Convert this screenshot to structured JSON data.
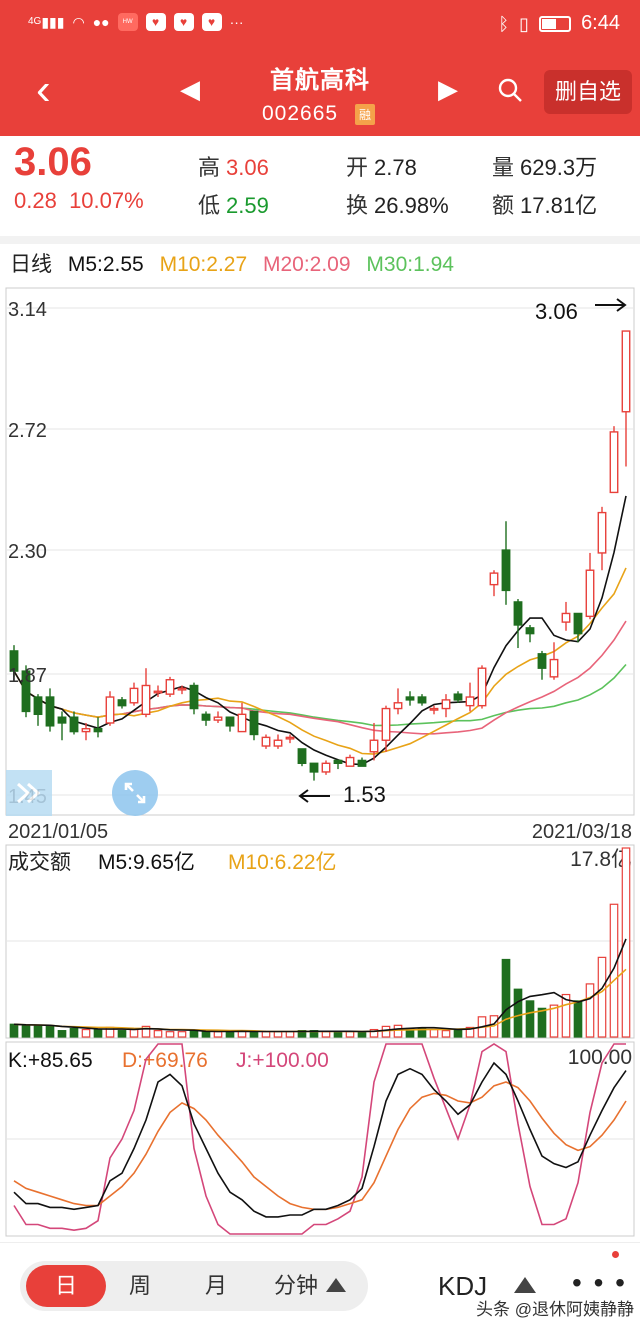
{
  "status_bar": {
    "network": "4G",
    "time": "6:44",
    "icons": [
      "signal-icon",
      "wifi-icon",
      "wechat-icon",
      "huawei-icon",
      "heart-icon",
      "heart-icon",
      "heart-icon",
      "more-dots-icon",
      "bluetooth-icon",
      "vibrate-icon",
      "battery-icon"
    ]
  },
  "header": {
    "title": "首航高科",
    "code": "002665",
    "badge": "融",
    "delete_button": "删自选"
  },
  "quote": {
    "price": "3.06",
    "change": "0.28",
    "change_pct": "10.07%",
    "high_label": "高",
    "high": "3.06",
    "low_label": "低",
    "low": "2.59",
    "open_label": "开",
    "open": "2.78",
    "turnover_label": "换",
    "turnover": "26.98%",
    "volume_label": "量",
    "volume": "629.3万",
    "amount_label": "额",
    "amount": "17.81亿"
  },
  "ma_legend": {
    "period": "日线",
    "m5": "M5:2.55",
    "m10": "M10:2.27",
    "m20": "M20:2.09",
    "m30": "M30:1.94"
  },
  "colors": {
    "up": "#e8403a",
    "down": "#1f6e1f",
    "m5": "#111111",
    "m10": "#e8a317",
    "m20": "#e8647a",
    "m30": "#5cc25c",
    "k": "#111111",
    "d": "#e8712f",
    "j": "#d4477a"
  },
  "chart_data": [
    {
      "type": "candlestick",
      "y_ticks": [
        "3.14",
        "2.72",
        "2.30",
        "1.87",
        "1.45"
      ],
      "ylim": [
        1.45,
        3.14
      ],
      "x_labels": [
        "2021/01/05",
        "2021/03/18"
      ],
      "annotations": {
        "high_label": "3.06",
        "low_label": "1.53"
      },
      "candles": [
        [
          1.95,
          1.88,
          1.97,
          1.86
        ],
        [
          1.88,
          1.74,
          1.9,
          1.72
        ],
        [
          1.79,
          1.73,
          1.8,
          1.69
        ],
        [
          1.79,
          1.69,
          1.82,
          1.67
        ],
        [
          1.72,
          1.7,
          1.74,
          1.64
        ],
        [
          1.72,
          1.67,
          1.74,
          1.66
        ],
        [
          1.67,
          1.68,
          1.7,
          1.64
        ],
        [
          1.68,
          1.67,
          1.72,
          1.65
        ],
        [
          1.7,
          1.79,
          1.81,
          1.69
        ],
        [
          1.78,
          1.76,
          1.79,
          1.75
        ],
        [
          1.77,
          1.82,
          1.84,
          1.76
        ],
        [
          1.73,
          1.83,
          1.89,
          1.72
        ],
        [
          1.81,
          1.81,
          1.83,
          1.79
        ],
        [
          1.8,
          1.85,
          1.86,
          1.79
        ],
        [
          1.82,
          1.82,
          1.83,
          1.8
        ],
        [
          1.83,
          1.75,
          1.84,
          1.73
        ],
        [
          1.73,
          1.71,
          1.74,
          1.69
        ],
        [
          1.71,
          1.72,
          1.74,
          1.7
        ],
        [
          1.72,
          1.69,
          1.72,
          1.67
        ],
        [
          1.67,
          1.73,
          1.77,
          1.67
        ],
        [
          1.74,
          1.66,
          1.74,
          1.64
        ],
        [
          1.62,
          1.65,
          1.66,
          1.61
        ],
        [
          1.62,
          1.64,
          1.66,
          1.61
        ],
        [
          1.65,
          1.65,
          1.66,
          1.63
        ],
        [
          1.61,
          1.56,
          1.61,
          1.55
        ],
        [
          1.56,
          1.53,
          1.56,
          1.5
        ],
        [
          1.53,
          1.56,
          1.57,
          1.52
        ],
        [
          1.57,
          1.56,
          1.57,
          1.54
        ],
        [
          1.55,
          1.58,
          1.59,
          1.55
        ],
        [
          1.57,
          1.55,
          1.58,
          1.55
        ],
        [
          1.6,
          1.64,
          1.7,
          1.57
        ],
        [
          1.64,
          1.75,
          1.76,
          1.6
        ],
        [
          1.75,
          1.77,
          1.82,
          1.73
        ],
        [
          1.79,
          1.78,
          1.81,
          1.76
        ],
        [
          1.79,
          1.77,
          1.8,
          1.76
        ],
        [
          1.75,
          1.75,
          1.76,
          1.73
        ],
        [
          1.75,
          1.78,
          1.8,
          1.72
        ],
        [
          1.8,
          1.78,
          1.81,
          1.77
        ],
        [
          1.76,
          1.79,
          1.84,
          1.74
        ],
        [
          1.76,
          1.89,
          1.9,
          1.75
        ],
        [
          2.18,
          2.22,
          2.23,
          2.14
        ],
        [
          2.3,
          2.16,
          2.4,
          2.11
        ],
        [
          2.12,
          2.04,
          2.13,
          1.96
        ],
        [
          2.03,
          2.01,
          2.04,
          1.98
        ],
        [
          1.94,
          1.89,
          1.95,
          1.85
        ],
        [
          1.86,
          1.92,
          1.98,
          1.85
        ],
        [
          2.05,
          2.08,
          2.12,
          2.02
        ],
        [
          2.08,
          2.01,
          2.08,
          1.98
        ],
        [
          2.07,
          2.23,
          2.29,
          2.06
        ],
        [
          2.29,
          2.43,
          2.45,
          2.23
        ],
        [
          2.5,
          2.71,
          2.73,
          2.52
        ],
        [
          2.78,
          3.06,
          3.06,
          2.59
        ]
      ]
    },
    {
      "type": "bar",
      "title": "成交额",
      "legend": {
        "m5": "M5:9.65亿",
        "m10": "M10:6.22亿"
      },
      "max_label": "17.8亿",
      "values": [
        1.2,
        1.1,
        1.1,
        1.0,
        0.6,
        0.8,
        0.7,
        0.7,
        0.9,
        0.6,
        0.7,
        1.0,
        0.6,
        0.5,
        0.5,
        0.6,
        0.5,
        0.5,
        0.5,
        0.6,
        0.5,
        0.5,
        0.5,
        0.5,
        0.6,
        0.6,
        0.5,
        0.5,
        0.5,
        0.5,
        0.7,
        1.0,
        1.1,
        0.8,
        0.8,
        0.7,
        0.6,
        0.7,
        0.9,
        1.9,
        2.0,
        7.3,
        4.5,
        3.4,
        2.7,
        3.0,
        4.0,
        3.4,
        5.0,
        7.5,
        12.5,
        17.8
      ]
    },
    {
      "type": "line",
      "title": "KDJ",
      "legend": {
        "k": "K:+85.65",
        "d": "D:+69.76",
        "j": "J:+100.00"
      },
      "max_label": "100.00",
      "ylim": [
        0,
        100
      ],
      "k": [
        22,
        16,
        16,
        14,
        14,
        13,
        14,
        15,
        28,
        32,
        45,
        60,
        80,
        84,
        78,
        58,
        45,
        32,
        22,
        18,
        12,
        9,
        9,
        10,
        10,
        13,
        13,
        15,
        18,
        24,
        46,
        70,
        84,
        87,
        84,
        76,
        70,
        63,
        68,
        80,
        90,
        84,
        70,
        55,
        41,
        37,
        35,
        38,
        52,
        65,
        77,
        86
      ],
      "d": [
        28,
        24,
        22,
        20,
        18,
        16,
        15,
        15,
        20,
        25,
        32,
        42,
        54,
        64,
        69,
        66,
        60,
        52,
        45,
        38,
        30,
        25,
        20,
        16,
        14,
        13,
        13,
        14,
        16,
        18,
        27,
        41,
        55,
        66,
        72,
        74,
        73,
        70,
        69,
        72,
        78,
        80,
        77,
        70,
        61,
        53,
        47,
        44,
        46,
        52,
        60,
        70
      ],
      "j": [
        15,
        5,
        5,
        3,
        3,
        2,
        3,
        7,
        40,
        50,
        65,
        92,
        100,
        100,
        100,
        45,
        20,
        5,
        0,
        0,
        0,
        0,
        0,
        0,
        0,
        5,
        5,
        8,
        12,
        30,
        80,
        100,
        100,
        100,
        100,
        82,
        66,
        50,
        68,
        96,
        100,
        96,
        58,
        25,
        5,
        5,
        8,
        27,
        64,
        90,
        100,
        100
      ]
    }
  ],
  "bottom": {
    "tabs": [
      "日",
      "周",
      "月",
      "分钟"
    ],
    "indicator": "KDJ",
    "more": "• • •",
    "watermark": "头条 @退休阿姨静静"
  }
}
